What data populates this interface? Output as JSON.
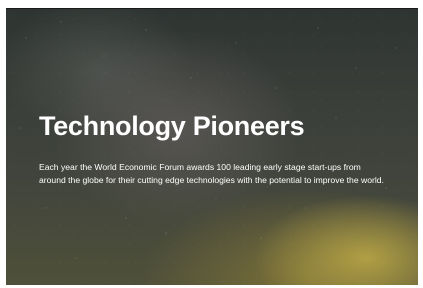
{
  "hero": {
    "title": "Technology Pioneers",
    "description": "Each year the World Economic Forum awards 100 leading early stage start-ups from around the globe for their cutting edge technologies with the potential to improve the world.",
    "background": "starry-night-sky-image"
  },
  "colors": {
    "text": "#ffffff",
    "sky_dark": "#2e3431",
    "glow": "#beaa46"
  }
}
